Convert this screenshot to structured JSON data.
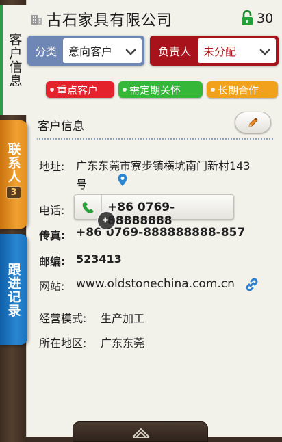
{
  "side_tabs": {
    "customer_info": "客户信息",
    "contacts": "联系人",
    "contacts_count": "3",
    "followup": "跟进记录"
  },
  "header": {
    "company_name": "古石家具有限公司",
    "lock_count": "30"
  },
  "filters": {
    "category_label": "分类",
    "category_value": "意向客户",
    "owner_label": "负责人",
    "owner_value": "未分配"
  },
  "tags": [
    "重点客户",
    "需定期关怀",
    "长期合作"
  ],
  "section": {
    "title": "客户信息"
  },
  "fields": {
    "address_label": "地址:",
    "address_value": "广东东莞市寮步镇横坑南门新村143号",
    "phone_label": "电话:",
    "phone_value": "+86 0769-88888888",
    "fax_label": "传真:",
    "fax_value": "+86 0769-888888888-857",
    "zip_label": "邮编:",
    "zip_value": "523413",
    "web_label": "网站:",
    "web_value": "www.oldstonechina.com.cn",
    "mode_label": "经营模式:",
    "mode_value": "生产加工",
    "region_label": "所在地区:",
    "region_value": "广东东莞"
  },
  "colors": {
    "category_accent": "#6f87b4",
    "owner_accent": "#a8121a",
    "tag_key": "#e3222c",
    "tag_periodic": "#35b83a",
    "tag_longterm": "#f2a11c",
    "contacts_tab": "#f0a132",
    "followup_tab": "#2a86d1"
  },
  "icons": {
    "building": "building-icon",
    "lock": "lock-icon",
    "edit": "pencil-icon",
    "location": "location-pin-icon",
    "phone": "phone-icon",
    "link": "link-icon",
    "zoom": "zoom-in-icon"
  }
}
